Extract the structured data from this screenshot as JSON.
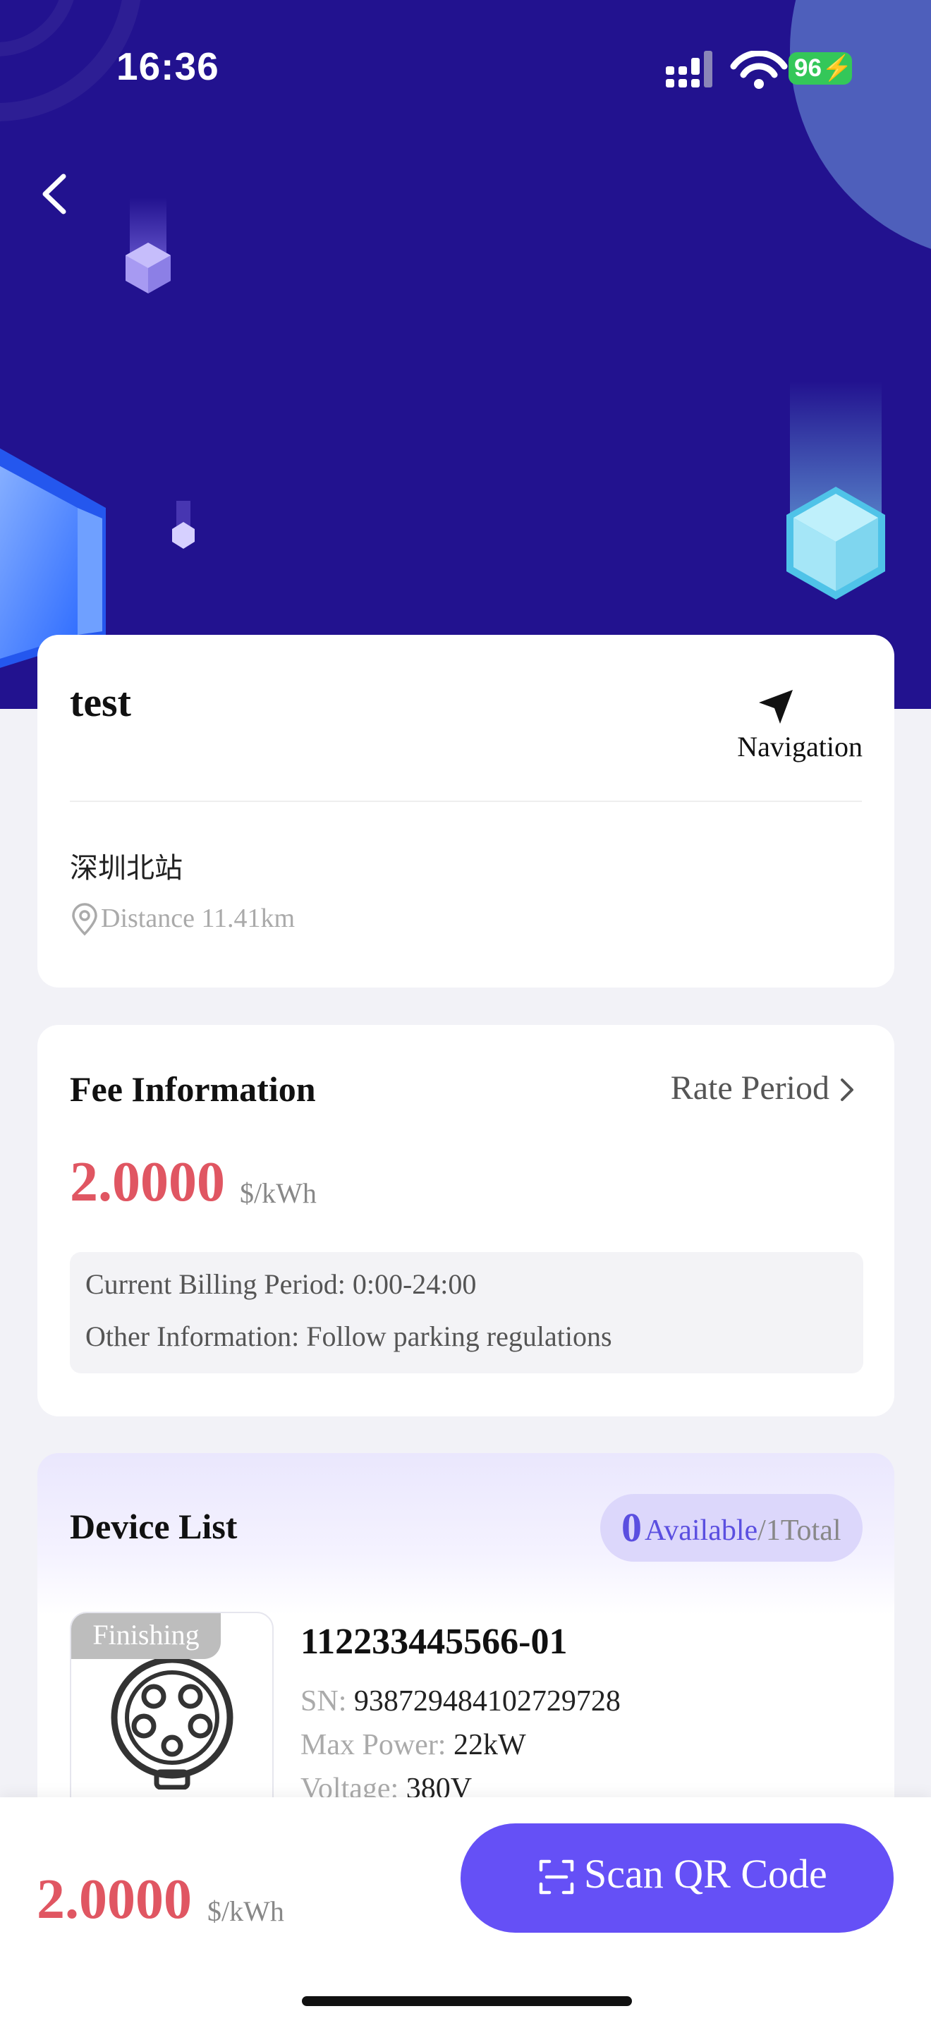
{
  "status_bar": {
    "time": "16:36",
    "battery": "96"
  },
  "station": {
    "name": "test",
    "nav_label": "Navigation",
    "address": "深圳北站",
    "distance": "Distance 11.41km"
  },
  "fee": {
    "title": "Fee Information",
    "rate_link": "Rate Period",
    "price": "2.0000",
    "unit": "$/kWh",
    "billing_label": "Current Billing Period:",
    "billing_value": "0:00-24:00",
    "other_label": "Other Information:",
    "other_value": "Follow parking regulations"
  },
  "devices": {
    "title": "Device List",
    "available_count": "0",
    "available_label": "Available",
    "total_label": "/1Total",
    "items": [
      {
        "status": "Finishing",
        "id": "112233445566-01",
        "sn_label": "SN:",
        "sn": "938729484102729728",
        "power_label": "Max Power:",
        "power": "22kW",
        "voltage_label": "Voltage:",
        "voltage": "380V"
      }
    ]
  },
  "bottom": {
    "price": "2.0000",
    "unit": "$/kWh",
    "scan_label": "Scan QR Code"
  },
  "colors": {
    "hero": "#22128f",
    "accent": "#6550f6",
    "price": "#e05662"
  }
}
